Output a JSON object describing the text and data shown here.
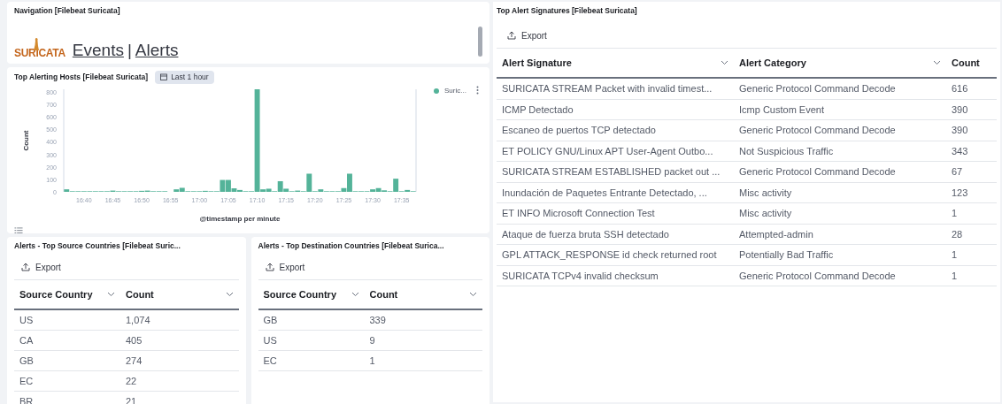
{
  "navigation": {
    "title": "Navigation [Filebeat Suricata]",
    "logo_text": "SURICATA",
    "links": [
      "Events",
      "Alerts"
    ],
    "separator": "|"
  },
  "hosts_chart": {
    "title": "Top Alerting Hosts [Filebeat Suricata]",
    "time_badge": "Last 1 hour",
    "chart_data": {
      "type": "bar",
      "xlabel": "@timestamp per minute",
      "ylabel": "Count",
      "x": [
        997,
        998,
        999,
        1000,
        1001,
        1002,
        1003,
        1004,
        1005,
        1006,
        1007,
        1008,
        1009,
        1010,
        1011,
        1012,
        1013,
        1014,
        1016,
        1017,
        1018,
        1019,
        1020,
        1021,
        1022,
        1023,
        1024,
        1025,
        1026,
        1027,
        1028,
        1029,
        1030,
        1031,
        1032,
        1033,
        1034,
        1035,
        1036,
        1037,
        1038,
        1039,
        1040,
        1041,
        1042,
        1043,
        1044,
        1045,
        1046,
        1047,
        1048,
        1049,
        1050,
        1051,
        1052,
        1053,
        1054,
        1055,
        1056,
        1057
      ],
      "xlim": [
        996.5,
        1057.5
      ],
      "series": [
        {
          "name": "Suric...",
          "color": "#54b399",
          "values": [
            20,
            5,
            5,
            5,
            5,
            5,
            5,
            5,
            10,
            5,
            5,
            5,
            5,
            8,
            10,
            5,
            5,
            5,
            20,
            32,
            5,
            5,
            5,
            8,
            5,
            5,
            95,
            95,
            28,
            15,
            5,
            5,
            820,
            20,
            25,
            5,
            85,
            25,
            5,
            10,
            5,
            145,
            5,
            20,
            5,
            5,
            5,
            30,
            145,
            5,
            5,
            5,
            20,
            30,
            12,
            5,
            105,
            5,
            15,
            5
          ]
        }
      ],
      "ylim": [
        0,
        820
      ],
      "yticks": [
        0,
        100,
        200,
        300,
        400,
        500,
        600,
        700,
        800
      ],
      "xticks": [
        {
          "value": 1000,
          "label": "16:40"
        },
        {
          "value": 1005,
          "label": "16:45"
        },
        {
          "value": 1010,
          "label": "16:50"
        },
        {
          "value": 1015,
          "label": "16:55"
        },
        {
          "value": 1020,
          "label": "17:00"
        },
        {
          "value": 1025,
          "label": "17:05"
        },
        {
          "value": 1030,
          "label": "17:10"
        },
        {
          "value": 1035,
          "label": "17:15"
        },
        {
          "value": 1040,
          "label": "17:20"
        },
        {
          "value": 1045,
          "label": "17:25"
        },
        {
          "value": 1050,
          "label": "17:30"
        },
        {
          "value": 1055,
          "label": "17:35"
        }
      ]
    }
  },
  "source_countries": {
    "title": "Alerts - Top Source Countries [Filebeat Suric...",
    "export": "Export",
    "columns": [
      "Source Country",
      "Count"
    ],
    "rows": [
      [
        "US",
        "1,074"
      ],
      [
        "CA",
        "405"
      ],
      [
        "GB",
        "274"
      ],
      [
        "EC",
        "22"
      ],
      [
        "BR",
        "21"
      ]
    ]
  },
  "destination_countries": {
    "title": "Alerts - Top Destination Countries [Filebeat Surica...",
    "export": "Export",
    "columns": [
      "Source Country",
      "Count"
    ],
    "rows": [
      [
        "GB",
        "339"
      ],
      [
        "US",
        "9"
      ],
      [
        "EC",
        "1"
      ]
    ]
  },
  "alert_signatures": {
    "title": "Top Alert Signatures [Filebeat Suricata]",
    "export": "Export",
    "columns": [
      "Alert Signature",
      "Alert Category",
      "Count"
    ],
    "rows": [
      [
        "SURICATA STREAM Packet with invalid timest...",
        "Generic Protocol Command Decode",
        "616"
      ],
      [
        "ICMP Detectado",
        "Icmp Custom Event",
        "390"
      ],
      [
        "Escaneo de puertos TCP detectado",
        "Generic Protocol Command Decode",
        "390"
      ],
      [
        "ET POLICY GNU/Linux APT User-Agent Outbo...",
        "Not Suspicious Traffic",
        "343"
      ],
      [
        "SURICATA STREAM ESTABLISHED packet out ...",
        "Generic Protocol Command Decode",
        "67"
      ],
      [
        "Inundación de Paquetes Entrante Detectado, ...",
        "Misc activity",
        "123"
      ],
      [
        "ET INFO Microsoft Connection Test",
        "Misc activity",
        "1"
      ],
      [
        "Ataque de fuerza bruta SSH detectado",
        "Attempted-admin",
        "28"
      ],
      [
        "GPL ATTACK_RESPONSE id check returned root",
        "Potentially Bad Traffic",
        "1"
      ],
      [
        "SURICATA TCPv4 invalid checksum",
        "Generic Protocol Command Decode",
        "1"
      ]
    ]
  }
}
